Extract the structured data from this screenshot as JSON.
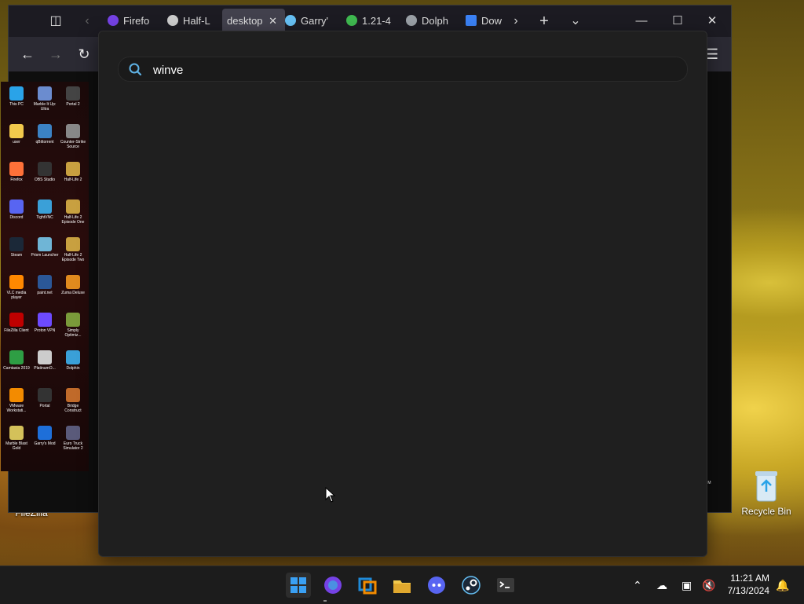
{
  "wallpaper": {
    "filezilla_label": "FileZilla",
    "recycle_bin_label": "Recycle Bin"
  },
  "browser": {
    "tabs": [
      {
        "label": "Firefo",
        "icon": "firefox-icon",
        "color": "#7542e5"
      },
      {
        "label": "Half-L",
        "icon": "half-life-icon",
        "color": "#cccccc"
      },
      {
        "label": "desktop",
        "icon": "",
        "color": "",
        "active": true
      },
      {
        "label": "Garry'",
        "icon": "steam-icon",
        "color": "#66c0f4"
      },
      {
        "label": "1.21-4",
        "icon": "green-circle-icon",
        "color": "#3fb950"
      },
      {
        "label": "Dolph",
        "icon": "dolphin-icon",
        "color": "#9aa0a6"
      },
      {
        "label": "Dow",
        "icon": "download-icon",
        "color": "#3b82f6"
      }
    ]
  },
  "remote_desktop": {
    "icons": [
      {
        "label": "This PC",
        "color": "#2aa3e8"
      },
      {
        "label": "Marble It Up: Ultra",
        "color": "#6b8ccf"
      },
      {
        "label": "Portal 2",
        "color": "#444444"
      },
      {
        "label": "user",
        "color": "#f2c94c"
      },
      {
        "label": "qBittorrent",
        "color": "#3b82c4"
      },
      {
        "label": "Counter-Strike Source",
        "color": "#888888"
      },
      {
        "label": "Firefox",
        "color": "#ff7139"
      },
      {
        "label": "OBS Studio",
        "color": "#333333"
      },
      {
        "label": "Half-Life 2",
        "color": "#c8a040"
      },
      {
        "label": "Discord",
        "color": "#5865f2"
      },
      {
        "label": "TightVNC",
        "color": "#3aa0d8"
      },
      {
        "label": "Half-Life 2 Episode One",
        "color": "#c8a040"
      },
      {
        "label": "Steam",
        "color": "#1b2838"
      },
      {
        "label": "Prism Launcher",
        "color": "#6fb5d6"
      },
      {
        "label": "Half-Life 2 Episode Two",
        "color": "#c8a040"
      },
      {
        "label": "VLC media player",
        "color": "#ff8800"
      },
      {
        "label": "paint.net",
        "color": "#2b5797"
      },
      {
        "label": "Zuma Deluxe",
        "color": "#e08a1e"
      },
      {
        "label": "FileZilla Client",
        "color": "#bf0000"
      },
      {
        "label": "Proton VPN",
        "color": "#6d4aff"
      },
      {
        "label": "Simply Optimiz...",
        "color": "#7a9a3a"
      },
      {
        "label": "Camtasia 2019",
        "color": "#2e9e44"
      },
      {
        "label": "PlatinumO...",
        "color": "#cccccc"
      },
      {
        "label": "Dolphin",
        "color": "#3aa0d8"
      },
      {
        "label": "VMware Workstati...",
        "color": "#f38b00"
      },
      {
        "label": "Portal",
        "color": "#333333"
      },
      {
        "label": "Bridge Construct",
        "color": "#c06a2a"
      },
      {
        "label": "Marble Blast Gold",
        "color": "#d4c15a"
      },
      {
        "label": "Garry's Mod",
        "color": "#1e6fd9"
      },
      {
        "label": "Euro Truck Simulator 2",
        "color": "#5a5a7a"
      }
    ]
  },
  "palette": {
    "search_value": "winve"
  },
  "taskbar": {
    "apps": [
      {
        "name": "start-button",
        "color": "#3aa0f3"
      },
      {
        "name": "firefox-app",
        "color": "#7542e5"
      },
      {
        "name": "vmware-app",
        "color": "#1f8ad8"
      },
      {
        "name": "file-explorer-app",
        "color": "#f2c94c"
      },
      {
        "name": "discord-app",
        "color": "#5865f2"
      },
      {
        "name": "steam-app",
        "color": "#1b2838"
      },
      {
        "name": "terminal-app",
        "color": "#3a3a3a"
      }
    ],
    "clock": {
      "time": "11:21 AM",
      "date": "7/13/2024"
    }
  }
}
